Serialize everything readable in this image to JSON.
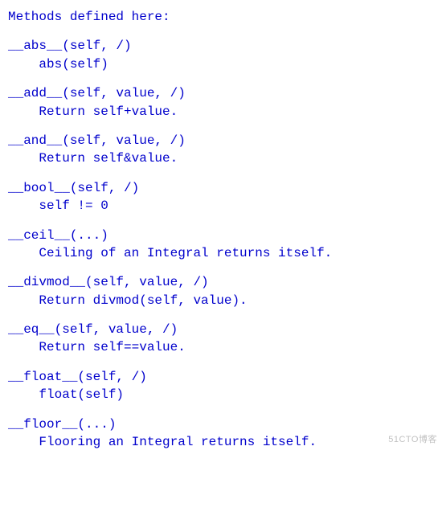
{
  "header": "Methods defined here:",
  "methods": [
    {
      "sig": "__abs__(self, /)",
      "doc": "abs(self)"
    },
    {
      "sig": "__add__(self, value, /)",
      "doc": "Return self+value."
    },
    {
      "sig": "__and__(self, value, /)",
      "doc": "Return self&value."
    },
    {
      "sig": "__bool__(self, /)",
      "doc": "self != 0"
    },
    {
      "sig": "__ceil__(...)",
      "doc": "Ceiling of an Integral returns itself."
    },
    {
      "sig": "__divmod__(self, value, /)",
      "doc": "Return divmod(self, value)."
    },
    {
      "sig": "__eq__(self, value, /)",
      "doc": "Return self==value."
    },
    {
      "sig": "__float__(self, /)",
      "doc": "float(self)"
    },
    {
      "sig": "__floor__(...)",
      "doc": "Flooring an Integral returns itself."
    }
  ],
  "watermark": "51CTO博客"
}
